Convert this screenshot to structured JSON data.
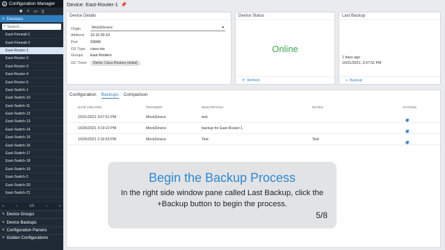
{
  "app": {
    "title": "Configuration Manager"
  },
  "sidebar": {
    "tool_icons": [
      "add-icon",
      "home-icon",
      "folder-icon",
      "file-icon"
    ],
    "active_section": "Devices",
    "search_placeholder": "Search...",
    "devices": [
      "East-Firewall-1",
      "East-Firewall-2",
      "East-Router-1",
      "East-Router-2",
      "East-Router-3",
      "East-Router-4",
      "East-Router-5",
      "East-Switch-1",
      "East-Switch-10",
      "East-Switch-11",
      "East-Switch-12",
      "East-Switch-13",
      "East-Switch-14",
      "East-Switch-15",
      "East-Switch-16",
      "East-Switch-17",
      "East-Switch-18",
      "East-Switch-19",
      "East-Switch-2",
      "East-Switch-20",
      "East-Switch-21"
    ],
    "selected_device": "East-Router-1",
    "pager": "1/5",
    "sections": [
      "Device Groups",
      "Device Backups",
      "Configuration Parsers",
      "Golden Configurations"
    ]
  },
  "header": {
    "title": "Device: East-Router-1"
  },
  "details": {
    "title": "Device Details",
    "origin_label": "Origin",
    "origin_value": "MockDevice",
    "address_label": "Address",
    "address_value": "10.10.30.10",
    "port_label": "Port",
    "port_value": "59999",
    "os_label": "OS Type",
    "os_value": "cisco-ios",
    "groups_label": "Groups",
    "groups_value": "East Routers",
    "gc_label": "GC Trees",
    "gc_value": "Demo: Cisco Routers (initial)"
  },
  "status": {
    "title": "Device Status",
    "value": "Online",
    "refresh_label": "Refresh",
    "online_color": "#3ea84a"
  },
  "last_backup": {
    "title": "Last Backup",
    "ago": "1 days ago",
    "timestamp": "10/21/2021, 3:07:51 PM",
    "backup_label": "Backup"
  },
  "tabs": [
    "Configuration",
    "Backups",
    "Comparison"
  ],
  "active_tab": "Backups",
  "backups_table": {
    "headers": [
      "DATE CREATED",
      "PROVIDER",
      "DESCRIPTION",
      "NOTES",
      "ACTIONS"
    ],
    "rows": [
      {
        "date": "10/21/2021 3:07:51 PM",
        "provider": "MockDevice",
        "description": "test",
        "notes": ""
      },
      {
        "date": "10/20/2021 3:19:22 PM",
        "provider": "MockDevice",
        "description": "backup for East-Router-1",
        "notes": ""
      },
      {
        "date": "10/20/2021 2:16:53 PM",
        "provider": "MockDevice",
        "description": "Test",
        "notes": "Test"
      }
    ]
  },
  "tutorial": {
    "title": "Begin the Backup Process",
    "body": "In the right side window pane called Last Backup, click the +Backup button to begin the process.",
    "step": "5/8"
  },
  "colors": {
    "accent": "#2f7fbf",
    "sidebar_bg": "#1f2a36"
  }
}
